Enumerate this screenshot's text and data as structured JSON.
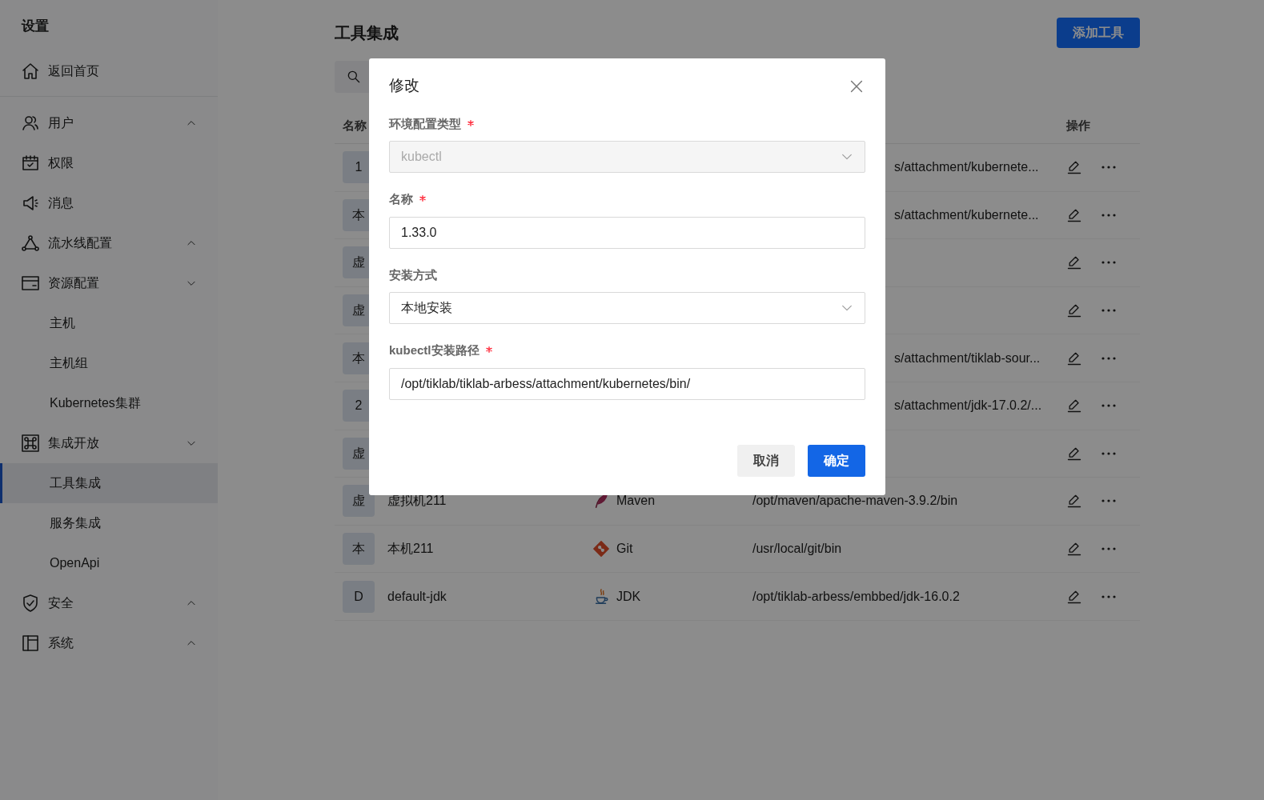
{
  "sidebar": {
    "title": "设置",
    "home": {
      "label": "返回首页"
    },
    "items": [
      {
        "label": "用户",
        "expanded": false
      },
      {
        "label": "权限"
      },
      {
        "label": "消息"
      },
      {
        "label": "流水线配置",
        "expanded": false
      },
      {
        "label": "资源配置",
        "expanded": true,
        "children": [
          {
            "label": "主机",
            "selected": false
          },
          {
            "label": "主机组",
            "selected": false
          },
          {
            "label": "Kubernetes集群",
            "selected": false
          }
        ]
      },
      {
        "label": "集成开放",
        "expanded": true,
        "children": [
          {
            "label": "工具集成",
            "selected": true
          },
          {
            "label": "服务集成",
            "selected": false
          },
          {
            "label": "OpenApi",
            "selected": false
          }
        ]
      },
      {
        "label": "安全",
        "expanded": false
      },
      {
        "label": "系统",
        "expanded": false
      }
    ]
  },
  "page": {
    "title": "工具集成",
    "add_button": "添加工具"
  },
  "table": {
    "columns": [
      "名称",
      "操作"
    ],
    "rows": [
      {
        "avatar": "1",
        "path": "s/attachment/kubernete..."
      },
      {
        "avatar": "本",
        "path": "s/attachment/kubernete..."
      },
      {
        "avatar": "虚"
      },
      {
        "avatar": "虚"
      },
      {
        "avatar": "本",
        "path": "s/attachment/tiklab-sour..."
      },
      {
        "avatar": "2",
        "path": "s/attachment/jdk-17.0.2/..."
      },
      {
        "avatar": "虚"
      },
      {
        "avatar": "虚",
        "name": "虚拟机211",
        "tool": "Maven",
        "path": "/opt/maven/apache-maven-3.9.2/bin"
      },
      {
        "avatar": "本",
        "name": "本机211",
        "tool": "Git",
        "path": "/usr/local/git/bin"
      },
      {
        "avatar": "D",
        "name": "default-jdk",
        "tool": "JDK",
        "path": "/opt/tiklab-arbess/embbed/jdk-16.0.2"
      }
    ]
  },
  "modal": {
    "title": "修改",
    "fields": [
      {
        "label": "环境配置类型",
        "required": true,
        "kind": "select",
        "value": "kubectl",
        "disabled": true
      },
      {
        "label": "名称",
        "required": true,
        "kind": "input",
        "value": "1.33.0",
        "disabled": false
      },
      {
        "label": "安装方式",
        "required": false,
        "kind": "select",
        "value": "本地安装",
        "disabled": false
      },
      {
        "label": "kubectl安装路径",
        "required": true,
        "kind": "input",
        "value": "/opt/tiklab/tiklab-arbess/attachment/kubernetes/bin/",
        "disabled": false
      }
    ],
    "cancel": "取消",
    "confirm": "确定"
  }
}
